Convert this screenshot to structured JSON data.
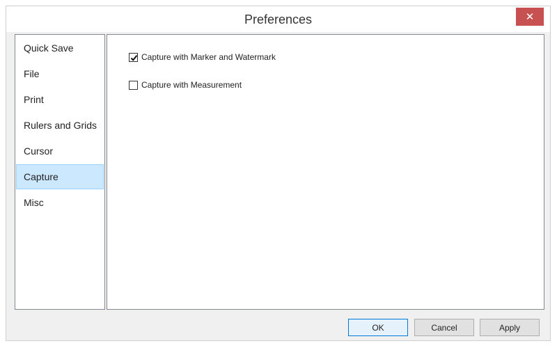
{
  "window": {
    "title": "Preferences",
    "close_glyph": "✕",
    "close_icon": "close-icon"
  },
  "sidebar": {
    "selected_index": 5,
    "items": [
      {
        "label": "Quick Save"
      },
      {
        "label": "File"
      },
      {
        "label": "Print"
      },
      {
        "label": "Rulers and Grids"
      },
      {
        "label": "Cursor"
      },
      {
        "label": "Capture"
      },
      {
        "label": "Misc"
      }
    ]
  },
  "capture_panel": {
    "options": [
      {
        "label": "Capture with Marker and Watermark",
        "checked": true
      },
      {
        "label": "Capture with Measurement",
        "checked": false
      }
    ]
  },
  "buttons": {
    "ok": "OK",
    "cancel": "Cancel",
    "apply": "Apply"
  },
  "colors": {
    "close_bg": "#c75050",
    "selected_bg": "#cce8ff",
    "selected_border": "#99d1ff",
    "default_button_border": "#0078d7"
  }
}
